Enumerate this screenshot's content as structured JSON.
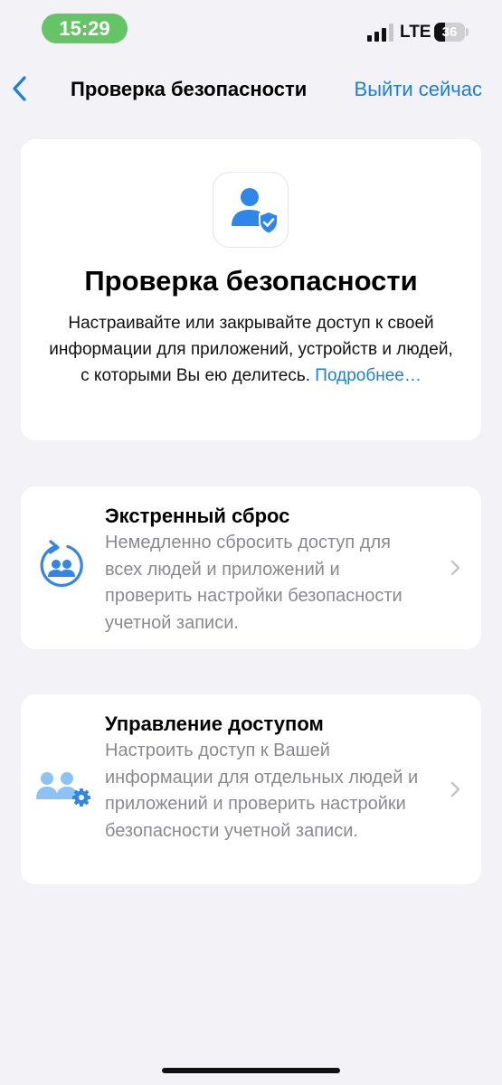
{
  "status_bar": {
    "time": "15:29",
    "network": "LTE",
    "battery_level": "36",
    "battery_fraction": 0.36
  },
  "nav": {
    "title": "Проверка безопасности",
    "action_label": "Выйти сейчас",
    "back_icon": "chevron-left-icon"
  },
  "hero": {
    "icon": "person-shield-icon",
    "title": "Проверка безопасности",
    "description": "Настраивайте или закрывайте доступ к своей информации для приложений, устройств и людей, с которыми Вы ею делитесь.",
    "link_label": "Подробнее…"
  },
  "options": [
    {
      "icon": "emergency-reset-icon",
      "title": "Экстренный сброс",
      "description": "Немедленно сбросить доступ для всех людей и приложений и проверить настройки без­опасности учетной записи."
    },
    {
      "icon": "manage-access-icon",
      "title": "Управление доступом",
      "description": "Настроить доступ к Вашей информации для отдельных людей и приложений и прове­рить настройки безопасности учетной записи."
    }
  ],
  "colors": {
    "accent": "#1a7fe0",
    "icon_blue": "#2f86e8",
    "icon_light_blue": "#8cc3f5",
    "time_pill": "#65c466",
    "background": "#f2f2f7",
    "secondary_text": "#8a8a8e"
  }
}
